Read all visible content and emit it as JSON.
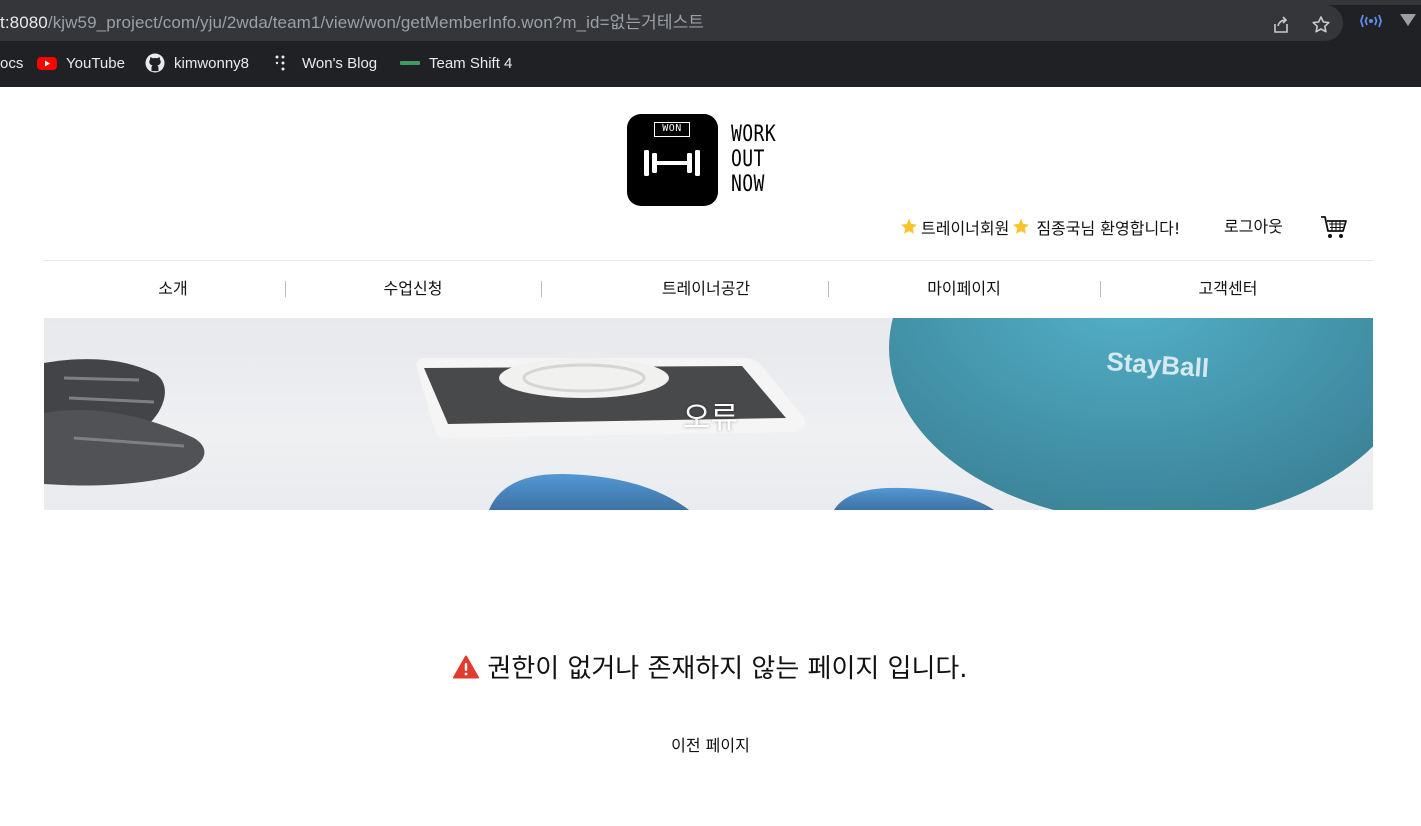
{
  "browser": {
    "url_prefix": "t:8080",
    "url_rest": "/kjw59_project/com/yju/2wda/team1/view/won/getMemberInfo.won?m_id=없는거테스트",
    "bookmarks": [
      {
        "label": "ocs",
        "icon": "docs-icon"
      },
      {
        "label": "YouTube",
        "icon": "youtube-icon"
      },
      {
        "label": "kimwonny8",
        "icon": "github-icon"
      },
      {
        "label": "Won's Blog",
        "icon": "blog-icon"
      },
      {
        "label": "Team Shift 4",
        "icon": "team-icon"
      }
    ]
  },
  "logo": {
    "badge": "WON",
    "lines": [
      "WORK",
      "OUT",
      "NOW"
    ]
  },
  "user": {
    "role": "트레이너회원",
    "greeting": "짐종국님 환영합니다!",
    "logout": "로그아웃"
  },
  "nav": {
    "items": [
      "소개",
      "수업신청",
      "트레이너공간",
      "마이페이지",
      "고객센터"
    ]
  },
  "banner": {
    "title": "오류",
    "ball_text": "StayBall"
  },
  "error": {
    "message": "권한이 없거나 존재하지 않는 페이지 입니다.",
    "back": "이전 페이지"
  },
  "colors": {
    "chrome_bg": "#202124",
    "address_bg": "#35363a",
    "warning_red": "#e23b2e",
    "star_yellow": "#f6c42d",
    "ball_teal": "#2b8fa9",
    "dumbbell_blue": "#2e78b8"
  }
}
